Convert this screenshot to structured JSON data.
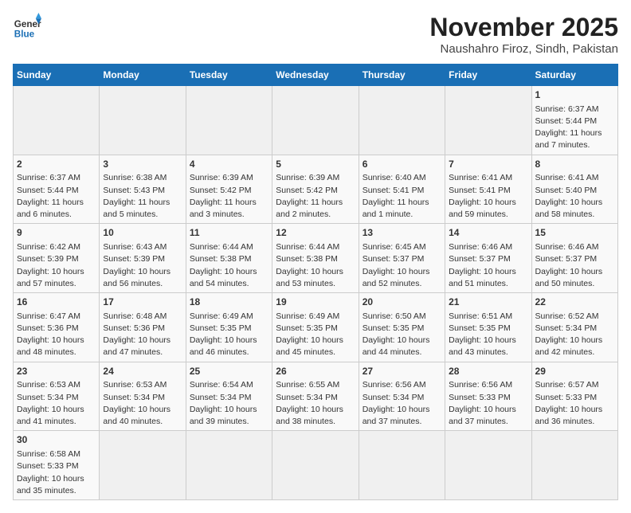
{
  "header": {
    "logo_line1": "General",
    "logo_line2": "Blue",
    "month": "November 2025",
    "location": "Naushahro Firoz, Sindh, Pakistan"
  },
  "days_of_week": [
    "Sunday",
    "Monday",
    "Tuesday",
    "Wednesday",
    "Thursday",
    "Friday",
    "Saturday"
  ],
  "weeks": [
    [
      {
        "day": "",
        "info": ""
      },
      {
        "day": "",
        "info": ""
      },
      {
        "day": "",
        "info": ""
      },
      {
        "day": "",
        "info": ""
      },
      {
        "day": "",
        "info": ""
      },
      {
        "day": "",
        "info": ""
      },
      {
        "day": "1",
        "info": "Sunrise: 6:37 AM\nSunset: 5:44 PM\nDaylight: 11 hours\nand 7 minutes."
      }
    ],
    [
      {
        "day": "2",
        "info": "Sunrise: 6:37 AM\nSunset: 5:44 PM\nDaylight: 11 hours\nand 6 minutes."
      },
      {
        "day": "3",
        "info": "Sunrise: 6:38 AM\nSunset: 5:43 PM\nDaylight: 11 hours\nand 5 minutes."
      },
      {
        "day": "4",
        "info": "Sunrise: 6:39 AM\nSunset: 5:42 PM\nDaylight: 11 hours\nand 3 minutes."
      },
      {
        "day": "5",
        "info": "Sunrise: 6:39 AM\nSunset: 5:42 PM\nDaylight: 11 hours\nand 2 minutes."
      },
      {
        "day": "6",
        "info": "Sunrise: 6:40 AM\nSunset: 5:41 PM\nDaylight: 11 hours\nand 1 minute."
      },
      {
        "day": "7",
        "info": "Sunrise: 6:41 AM\nSunset: 5:41 PM\nDaylight: 10 hours\nand 59 minutes."
      },
      {
        "day": "8",
        "info": "Sunrise: 6:41 AM\nSunset: 5:40 PM\nDaylight: 10 hours\nand 58 minutes."
      }
    ],
    [
      {
        "day": "9",
        "info": "Sunrise: 6:42 AM\nSunset: 5:39 PM\nDaylight: 10 hours\nand 57 minutes."
      },
      {
        "day": "10",
        "info": "Sunrise: 6:43 AM\nSunset: 5:39 PM\nDaylight: 10 hours\nand 56 minutes."
      },
      {
        "day": "11",
        "info": "Sunrise: 6:44 AM\nSunset: 5:38 PM\nDaylight: 10 hours\nand 54 minutes."
      },
      {
        "day": "12",
        "info": "Sunrise: 6:44 AM\nSunset: 5:38 PM\nDaylight: 10 hours\nand 53 minutes."
      },
      {
        "day": "13",
        "info": "Sunrise: 6:45 AM\nSunset: 5:37 PM\nDaylight: 10 hours\nand 52 minutes."
      },
      {
        "day": "14",
        "info": "Sunrise: 6:46 AM\nSunset: 5:37 PM\nDaylight: 10 hours\nand 51 minutes."
      },
      {
        "day": "15",
        "info": "Sunrise: 6:46 AM\nSunset: 5:37 PM\nDaylight: 10 hours\nand 50 minutes."
      }
    ],
    [
      {
        "day": "16",
        "info": "Sunrise: 6:47 AM\nSunset: 5:36 PM\nDaylight: 10 hours\nand 48 minutes."
      },
      {
        "day": "17",
        "info": "Sunrise: 6:48 AM\nSunset: 5:36 PM\nDaylight: 10 hours\nand 47 minutes."
      },
      {
        "day": "18",
        "info": "Sunrise: 6:49 AM\nSunset: 5:35 PM\nDaylight: 10 hours\nand 46 minutes."
      },
      {
        "day": "19",
        "info": "Sunrise: 6:49 AM\nSunset: 5:35 PM\nDaylight: 10 hours\nand 45 minutes."
      },
      {
        "day": "20",
        "info": "Sunrise: 6:50 AM\nSunset: 5:35 PM\nDaylight: 10 hours\nand 44 minutes."
      },
      {
        "day": "21",
        "info": "Sunrise: 6:51 AM\nSunset: 5:35 PM\nDaylight: 10 hours\nand 43 minutes."
      },
      {
        "day": "22",
        "info": "Sunrise: 6:52 AM\nSunset: 5:34 PM\nDaylight: 10 hours\nand 42 minutes."
      }
    ],
    [
      {
        "day": "23",
        "info": "Sunrise: 6:53 AM\nSunset: 5:34 PM\nDaylight: 10 hours\nand 41 minutes."
      },
      {
        "day": "24",
        "info": "Sunrise: 6:53 AM\nSunset: 5:34 PM\nDaylight: 10 hours\nand 40 minutes."
      },
      {
        "day": "25",
        "info": "Sunrise: 6:54 AM\nSunset: 5:34 PM\nDaylight: 10 hours\nand 39 minutes."
      },
      {
        "day": "26",
        "info": "Sunrise: 6:55 AM\nSunset: 5:34 PM\nDaylight: 10 hours\nand 38 minutes."
      },
      {
        "day": "27",
        "info": "Sunrise: 6:56 AM\nSunset: 5:34 PM\nDaylight: 10 hours\nand 37 minutes."
      },
      {
        "day": "28",
        "info": "Sunrise: 6:56 AM\nSunset: 5:33 PM\nDaylight: 10 hours\nand 37 minutes."
      },
      {
        "day": "29",
        "info": "Sunrise: 6:57 AM\nSunset: 5:33 PM\nDaylight: 10 hours\nand 36 minutes."
      }
    ],
    [
      {
        "day": "30",
        "info": "Sunrise: 6:58 AM\nSunset: 5:33 PM\nDaylight: 10 hours\nand 35 minutes."
      },
      {
        "day": "",
        "info": ""
      },
      {
        "day": "",
        "info": ""
      },
      {
        "day": "",
        "info": ""
      },
      {
        "day": "",
        "info": ""
      },
      {
        "day": "",
        "info": ""
      },
      {
        "day": "",
        "info": ""
      }
    ]
  ]
}
